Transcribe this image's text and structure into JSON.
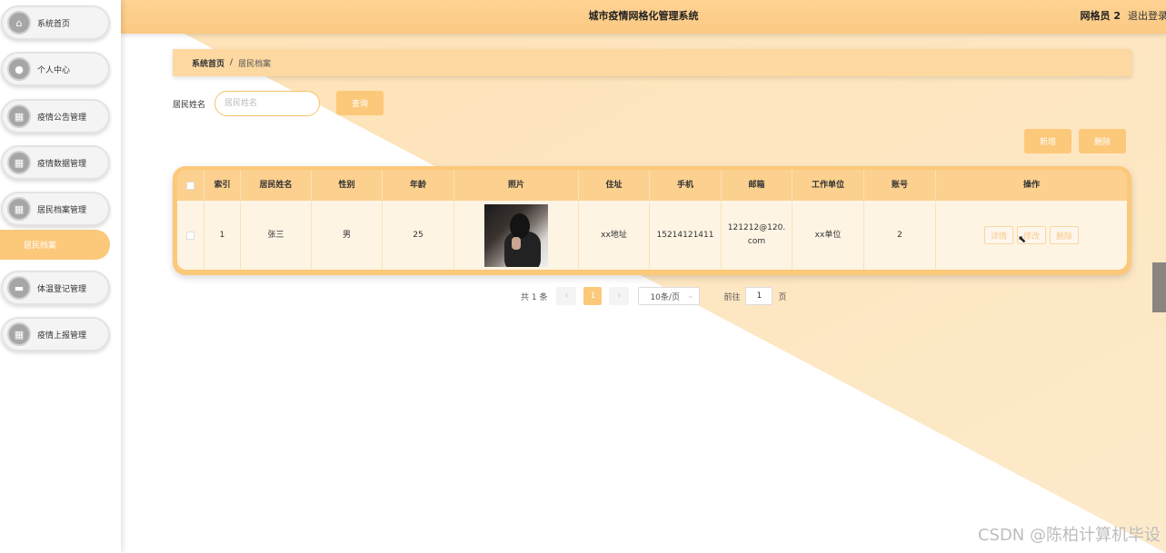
{
  "app": {
    "title": "城市疫情网格化管理系统",
    "user": "网格员 2",
    "logout": "退出登录"
  },
  "sidebar": {
    "items": [
      {
        "label": "系统首页",
        "icon": "home-icon"
      },
      {
        "label": "个人中心",
        "icon": "user-icon"
      },
      {
        "label": "疫情公告管理",
        "icon": "grid-icon"
      },
      {
        "label": "疫情数据管理",
        "icon": "grid-icon"
      },
      {
        "label": "居民档案管理",
        "icon": "grid-icon"
      },
      {
        "label": "体温登记管理",
        "icon": "chat-icon"
      },
      {
        "label": "疫情上报管理",
        "icon": "grid-icon"
      }
    ],
    "sub_active": "居民档案"
  },
  "breadcrumb": {
    "home": "系统首页",
    "sep": "/",
    "current": "居民档案"
  },
  "search": {
    "label": "居民姓名",
    "placeholder": "居民姓名",
    "button": "查询"
  },
  "actions": {
    "add": "新增",
    "delete": "删除"
  },
  "table": {
    "headers": [
      "索引",
      "居民姓名",
      "性别",
      "年龄",
      "照片",
      "住址",
      "手机",
      "邮箱",
      "工作单位",
      "账号",
      "操作"
    ],
    "rows": [
      {
        "index": "1",
        "name": "张三",
        "gender": "男",
        "age": "25",
        "address": "xx地址",
        "phone": "15214121411",
        "email": "121212@120.com",
        "work": "xx单位",
        "account": "2",
        "ops": {
          "detail": "详情",
          "edit": "修改",
          "delete": "删除"
        }
      }
    ]
  },
  "pager": {
    "total": "共 1 条",
    "prev": "‹",
    "current": "1",
    "next": "›",
    "size": "10条/页",
    "goto": "前往",
    "goto_value": "1",
    "page_unit": "页"
  },
  "watermark": "CSDN @陈柏计算机毕设",
  "colors": {
    "accent": "#fcc87a",
    "header": "#fdd394",
    "row": "#fdf4e4"
  }
}
